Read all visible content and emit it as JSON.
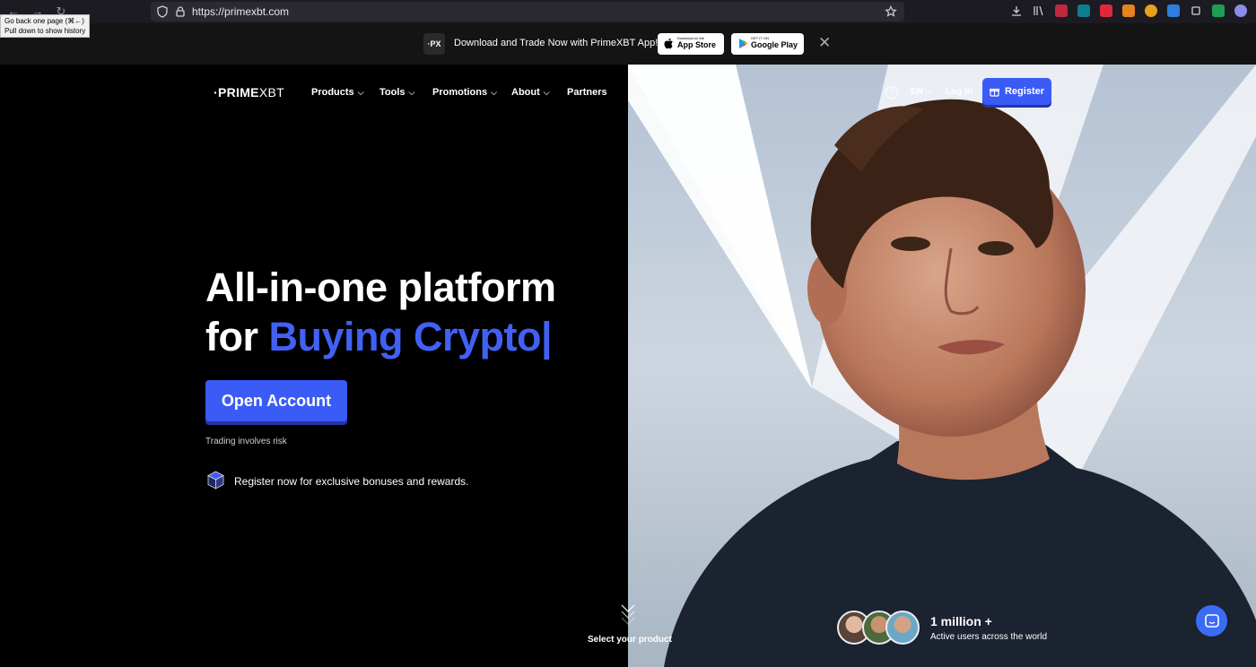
{
  "browser": {
    "url": "https://primexbt.com",
    "tooltip_line1": "Go back one page (⌘←)",
    "tooltip_line2": "Pull down to show history"
  },
  "promo": {
    "logo_text": "·PX",
    "text": "Download and Trade Now with PrimeXBT App!",
    "app_store_small": "Download on the",
    "app_store_big": "App Store",
    "google_play_small": "GET IT ON",
    "google_play_big": "Google Play"
  },
  "header": {
    "logo_bold": "·PRIME",
    "logo_light": "XBT",
    "nav": [
      {
        "label": "Products",
        "has_dropdown": true
      },
      {
        "label": "Tools",
        "has_dropdown": true
      },
      {
        "label": "Promotions",
        "has_dropdown": true
      },
      {
        "label": "About",
        "has_dropdown": true
      },
      {
        "label": "Partners",
        "has_dropdown": false
      }
    ],
    "help_glyph": "?",
    "language": "EN",
    "login_label": "Log in",
    "register_label": "Register"
  },
  "hero": {
    "headline_line1": "All-in-one platform",
    "headline_for": "for ",
    "headline_accent": "Buying Crypto|",
    "cta_label": "Open Account",
    "risk_note": "Trading involves risk",
    "bonus_text": "Register now for exclusive bonuses and rewards.",
    "scroll_label": "Select your product"
  },
  "stats": {
    "users_count": "1 million +",
    "users_label": "Active users across the world"
  },
  "colors": {
    "accent": "#3b5bf6",
    "headline_accent": "#4161f5",
    "background": "#000000"
  }
}
